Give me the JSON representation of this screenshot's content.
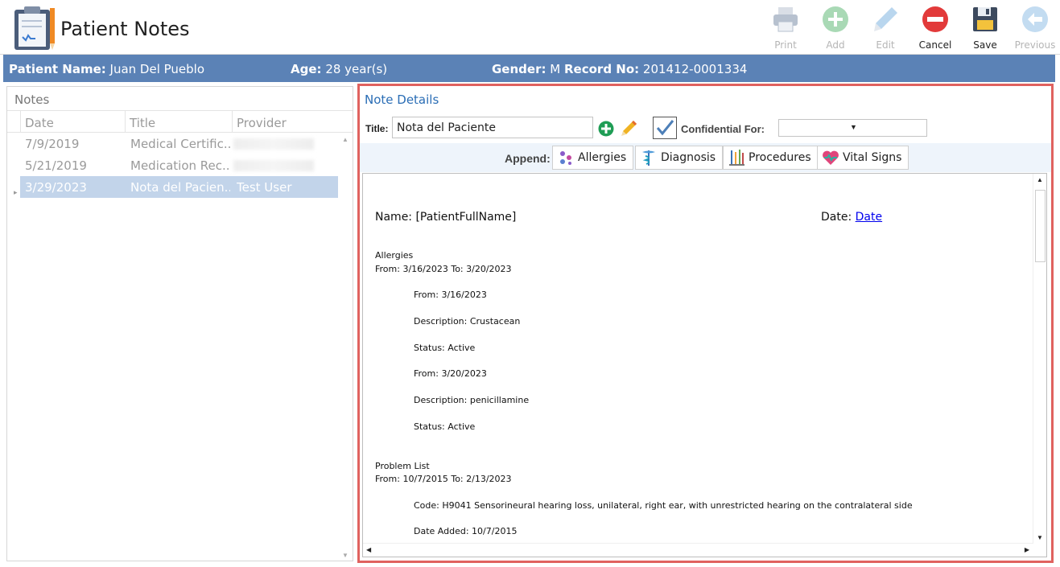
{
  "app": {
    "title": "Patient Notes"
  },
  "toolbar": {
    "print": "Print",
    "add": "Add",
    "edit": "Edit",
    "cancel": "Cancel",
    "save": "Save",
    "previous": "Previous"
  },
  "patient": {
    "name_label": "Patient Name:",
    "name": "Juan Del Pueblo",
    "age_label": "Age:",
    "age": "28 year(s)",
    "gender_label": "Gender:",
    "gender": "M",
    "record_label": "Record No:",
    "record": "201412-0001334"
  },
  "notes": {
    "title": "Notes",
    "columns": [
      "Date",
      "Title",
      "Provider"
    ],
    "rows": [
      {
        "date": "7/9/2019",
        "title": "Medical Certific...",
        "provider": ""
      },
      {
        "date": "5/21/2019",
        "title": "Medication Rec...",
        "provider": ""
      },
      {
        "date": "3/29/2023",
        "title": "Nota del Pacien...",
        "provider": "Test User"
      }
    ]
  },
  "details": {
    "title": "Note Details",
    "title_label": "Title:",
    "title_value": "Nota del Paciente",
    "confidential_label": "Confidential For:",
    "confidential_value": "",
    "append_label": "Append:",
    "append_buttons": {
      "allergies": "Allergies",
      "diagnosis": "Diagnosis",
      "procedures": "Procedures",
      "vital_signs": "Vital Signs"
    }
  },
  "document": {
    "name_line": "Name: [PatientFullName]",
    "date_label": "Date: ",
    "date_link": "Date",
    "lines": [
      "Allergies",
      "From: 3/16/2023 To: 3/20/2023",
      "From: 3/16/2023",
      "Description: Crustacean",
      "Status: Active",
      "From: 3/20/2023",
      "Description: penicillamine",
      "Status: Active",
      "Problem List",
      "From: 10/7/2015 To: 2/13/2023",
      "Code: H9041 Sensorineural hearing loss, unilateral, right ear, with unrestricted hearing on the contralateral side",
      "Date Added: 10/7/2015"
    ]
  },
  "colors": {
    "patient_bar": "#5b82b6",
    "highlight_border": "#e0625f",
    "selected_row": "#c2d4ea",
    "section_title": "#2a6db5"
  }
}
